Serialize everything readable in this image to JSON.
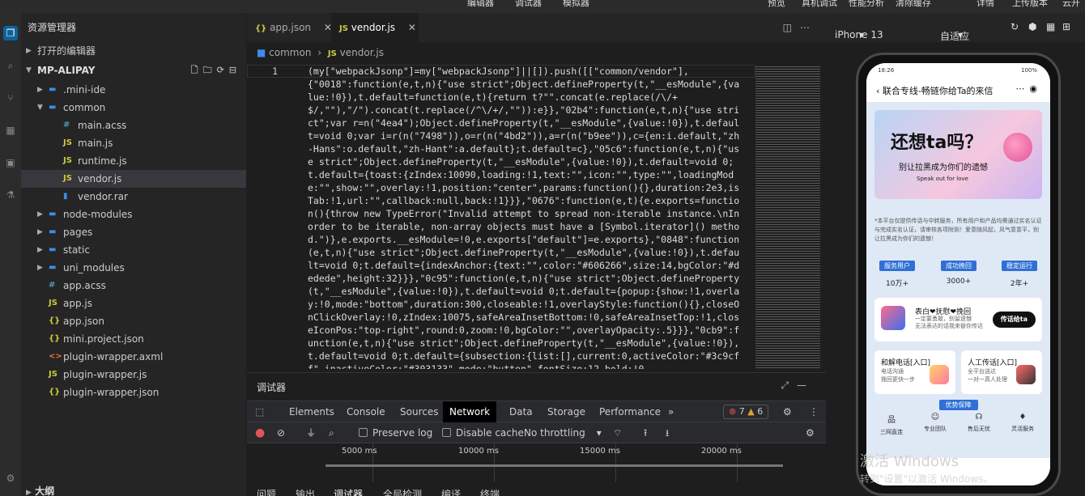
{
  "topbar": {
    "items": [
      "编辑器",
      "调试器",
      "模拟器",
      "预览",
      "真机调试",
      "性能分析",
      "清除缓存",
      "详情",
      "上传版本",
      "云开"
    ]
  },
  "explorer": {
    "title": "资源管理器",
    "open_editors": "打开的编辑器",
    "project": "MP-ALIPAY",
    "tree": [
      {
        "label": ".mini-ide",
        "type": "folder",
        "depth": 1,
        "open": false
      },
      {
        "label": "common",
        "type": "folder",
        "depth": 1,
        "open": true
      },
      {
        "label": "main.acss",
        "type": "acss",
        "depth": 2
      },
      {
        "label": "main.js",
        "type": "js",
        "depth": 2
      },
      {
        "label": "runtime.js",
        "type": "js",
        "depth": 2
      },
      {
        "label": "vendor.js",
        "type": "js",
        "depth": 2,
        "selected": true
      },
      {
        "label": "vendor.rar",
        "type": "rar",
        "depth": 2
      },
      {
        "label": "node-modules",
        "type": "folder",
        "depth": 1,
        "open": false
      },
      {
        "label": "pages",
        "type": "folder",
        "depth": 1,
        "open": false
      },
      {
        "label": "static",
        "type": "folder",
        "depth": 1,
        "open": false
      },
      {
        "label": "uni_modules",
        "type": "folder",
        "depth": 1,
        "open": false
      },
      {
        "label": "app.acss",
        "type": "acss",
        "depth": 1
      },
      {
        "label": "app.js",
        "type": "js",
        "depth": 1
      },
      {
        "label": "app.json",
        "type": "json",
        "depth": 1
      },
      {
        "label": "mini.project.json",
        "type": "json",
        "depth": 1
      },
      {
        "label": "plugin-wrapper.axml",
        "type": "xml",
        "depth": 1
      },
      {
        "label": "plugin-wrapper.js",
        "type": "js",
        "depth": 1
      },
      {
        "label": "plugin-wrapper.json",
        "type": "json",
        "depth": 1
      }
    ],
    "outline": "大纲"
  },
  "editor": {
    "tabs": [
      {
        "icon": "{}",
        "label": "app.json"
      },
      {
        "icon": "JS",
        "label": "vendor.js"
      }
    ],
    "breadcrumb": [
      "common",
      "vendor.js"
    ],
    "line_number": "1",
    "code": "(my[\"webpackJsonp\"]=my[\"webpackJsonp\"]||[]).push([[\"common/vendor\"],\n{\"0018\":function(e,t,n){\"use strict\";Object.defineProperty(t,\"__esModule\",{value:!0}),t.default=function(e,t){return t?\"\".concat(e.replace(/\\/+$/,\"\"),\"/\").concat(t.replace(/^\\/+/,\"\")):e}},\"02b4\":function(e,t,n){\"use strict\";var r=n(\"4ea4\");Object.defineProperty(t,\"__esModule\",{value:!0}),t.default=void 0;var i=r(n(\"7498\")),o=r(n(\"4bd2\")),a=r(n(\"b9ee\")),c={en:i.default,\"zh-Hans\":o.default,\"zh-Hant\":a.default};t.default=c},\"05c6\":function(e,t,n){\"use strict\";Object.defineProperty(t,\"__esModule\",{value:!0}),t.default=void 0;t.default={toast:{zIndex:10090,loading:!1,text:\"\",icon:\"\",type:\"\",loadingMode:\"\",show:\"\",overlay:!1,position:\"center\",params:function(){},duration:2e3,isTab:!1,url:\"\",callback:null,back:!1}}},\"0676\":function(e,t){e.exports=function(){throw new TypeError(\"Invalid attempt to spread non-iterable instance.\\nIn order to be iterable, non-array objects must have a [Symbol.iterator]() method.\")},e.exports.__esModule=!0,e.exports[\"default\"]=e.exports},\"0848\":function(e,t,n){\"use strict\";Object.defineProperty(t,\"__esModule\",{value:!0}),t.default=void 0;t.default={indexAnchor:{text:\"\",color:\"#606266\",size:14,bgColor:\"#dedede\",height:32}}},\"0c95\":function(e,t,n){\"use strict\";Object.defineProperty(t,\"__esModule\",{value:!0}),t.default=void 0;t.default={popup:{show:!1,overlay:!0,mode:\"bottom\",duration:300,closeable:!1,overlayStyle:function(){},closeOnClickOverlay:!0,zIndex:10075,safeAreaInsetBottom:!0,safeAreaInsetTop:!1,closeIconPos:\"top-right\",round:0,zoom:!0,bgColor:\"\",overlayOpacity:.5}}},\"0cb9\":function(e,t,n){\"use strict\";Object.defineProperty(t,\"__esModule\",{value:!0}),t.default=void 0;t.default={subsection:{list:[],current:0,activeColor:\"#3c9cff\",inactiveColor:\"#303133\",mode:\"button\",fontSize:12,bold:!0,"
  },
  "debugger": {
    "title": "调试器",
    "tabs": [
      "Elements",
      "Console",
      "Sources",
      "Network",
      "Data",
      "Storage",
      "Performance"
    ],
    "more": "»",
    "errors": "7",
    "warnings": "6",
    "preserve_log": "Preserve log",
    "disable_cache": "Disable cache",
    "throttling": "No throttling",
    "timeline": [
      "5000 ms",
      "10000 ms",
      "15000 ms",
      "20000 ms"
    ],
    "bottom_tabs": [
      "问题",
      "输出",
      "调试器",
      "全局检测",
      "编译",
      "终端"
    ]
  },
  "simulator": {
    "device": "iPhone 13",
    "fit": "自适应",
    "status_time": "18:26",
    "battery": "100%",
    "page_title": "联合专线-畅链你给Ta的来信",
    "banner_title": "还想ta吗？",
    "banner_sub": "别让拉黑成为你们的遗憾",
    "banner_en": "Speak out for love",
    "notice": "*本平台仅提供传话与中转服务，所有用户和产品均需通过实名认证与完成实名认证，请审核各项附则！爱意随风起，风气意意平，别让拉黑成为你们的遗憾！",
    "stats": [
      {
        "k": "服务用户",
        "v": "10万+"
      },
      {
        "k": "成功挽回",
        "v": "3000+"
      },
      {
        "k": "稳定运行",
        "v": "2年+"
      }
    ],
    "card1": {
      "title": "表白❤抚慰❤挽回",
      "sub1": "一定要勇敢，别留遗憾",
      "sub2": "无法表达的话我来替你传达",
      "button": "传话给ta"
    },
    "card2": [
      {
        "title": "和解电话[入口]",
        "sub1": "电话沟通",
        "sub2": "挽回更快一步"
      },
      {
        "title": "人工传话[入口]",
        "sub1": "全平台送达",
        "sub2": "一对一真人处理"
      }
    ],
    "guarantee": "优势保障",
    "services": [
      {
        "icon": "品",
        "label": "三网直连"
      },
      {
        "icon": "☺",
        "label": "专业团队"
      },
      {
        "icon": "☊",
        "label": "售后无忧"
      },
      {
        "icon": "♦",
        "label": "灵活服务"
      }
    ]
  },
  "watermark": {
    "line1": "激活 Windows",
    "line2": "转到\"设置\"以激活 Windows。"
  },
  "colors": {
    "accent": "#0e639c",
    "selected": "#37373d",
    "js": "#cbcb41",
    "json": "#cbcb41",
    "acss": "#519aba",
    "folder": "#3b8eea",
    "error": "#e05555",
    "warning": "#e0a030"
  }
}
